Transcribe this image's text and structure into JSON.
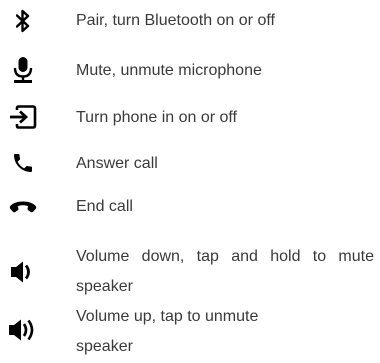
{
  "legend": {
    "items": [
      {
        "icon": "bluetooth-icon",
        "label": "Pair, turn Bluetooth on or off"
      },
      {
        "icon": "microphone-icon",
        "label": "Mute, unmute microphone"
      },
      {
        "icon": "power-input-icon",
        "label": "Turn phone in on or off"
      },
      {
        "icon": "phone-answer-icon",
        "label": "Answer call"
      },
      {
        "icon": "phone-end-icon",
        "label": "End call"
      },
      {
        "icon": "volume-down-icon",
        "label": "Volume down, tap and hold to mute speaker"
      },
      {
        "icon": "volume-up-icon",
        "label": "Volume up, tap to unmute speaker"
      }
    ]
  },
  "colors": {
    "icon": "#000000",
    "text": "#3a3a3a"
  }
}
